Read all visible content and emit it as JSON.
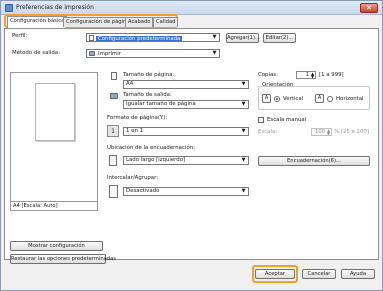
{
  "window": {
    "title": "Preferencias de impresión",
    "close_glyph": "✕"
  },
  "tabs": [
    {
      "label": "Configuración básica",
      "active": true
    },
    {
      "label": "Configuración de página",
      "active": false
    },
    {
      "label": "Acabado",
      "active": false
    },
    {
      "label": "Calidad",
      "active": false
    }
  ],
  "profile": {
    "label": "Perfil:",
    "value": "Configuración predeterminada",
    "add_button": "Agregar(1)...",
    "edit_button": "Editar(2)..."
  },
  "output_method": {
    "label": "Método de salida:",
    "value": "Imprimir"
  },
  "page_size": {
    "label": "Tamaño de página:",
    "value": "A4"
  },
  "output_size": {
    "label": "Tamaño de salida:",
    "value": "Igualar tamaño de página"
  },
  "page_format": {
    "label": "Formato de página(Y):",
    "value": "1 en 1",
    "icon_text": "1"
  },
  "binding_location": {
    "label": "Ubicación de la encuadernación:",
    "value": "Lado largo [izquierdo]"
  },
  "collate": {
    "label": "Intercalar/Agrupar:",
    "value": "Desactivado"
  },
  "copies": {
    "label": "Copias:",
    "value": "1",
    "range": "[1 a 999]"
  },
  "orientation": {
    "label": "Orientación",
    "portrait_label": "Vertical",
    "landscape_label": "Horizontal",
    "portrait_glyph": "A",
    "landscape_glyph": "A",
    "selected": "Vertical"
  },
  "manual_scale": {
    "label": "Escala manual",
    "checked": false,
    "scale_label": "Escala:",
    "scale_value": "100",
    "scale_range": "% [25 a 200]"
  },
  "binding_button": "Encuadernación(6)...",
  "preview": {
    "status": "A4 [Escala: Auto]"
  },
  "left_buttons": {
    "show_settings": "Mostrar configuración",
    "restore_defaults": "Restaurar las opciones predeterminadas"
  },
  "footer": {
    "accept": "Aceptar",
    "cancel": "Cancelar",
    "help": "Ayuda"
  },
  "colors": {
    "accent_highlight": "#f2a030",
    "selection_blue": "#3a73c9"
  }
}
